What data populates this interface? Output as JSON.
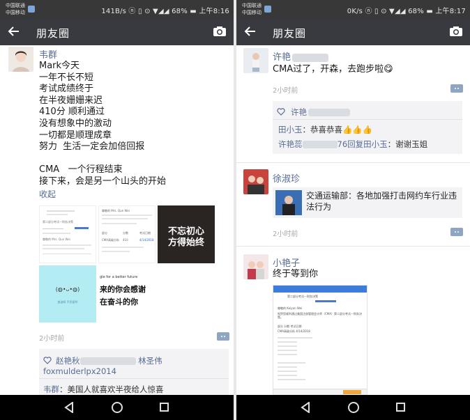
{
  "left": {
    "status": {
      "carrier1": "中国联通",
      "carrier2": "中国移动",
      "right": "141B/s ⓝ ▯ ⊙ ▼◢◢ 68% ▬ 上午8:16"
    },
    "title": "朋友圈",
    "post": {
      "author": "韦群",
      "text": "Mark今天\n一年不长不短\n考试成绩终于\n在半夜姗姗来迟\n410分 顺利通过\n没有想象中的激动\n一切都是顺理成章\n努力  生活一定会加倍回报\n\nCMA   一个行程结束\n接下来，会是另一个山头的开始",
      "collapse": "收起",
      "img_docA": {
        "label": "第二部分考试—财务决策",
        "name": "尊敬的 Mrs. Qun Wei"
      },
      "img_docB": {
        "name": "尊敬的 Mrs. Qun Wei",
        "head1": "部分",
        "head2": "分数",
        "head3": "考试日期",
        "row_part": "CMA高级分析",
        "row_score": "410",
        "row_date": "4/14/2018"
      },
      "img_dark": {
        "line1": "不忘初心",
        "line2": "方得始终"
      },
      "img_cyan": {
        "face": "(◍•ᴗ•◍)",
        "caption": "加油呀  不负韶华"
      },
      "img_calli": {
        "top": "gle for a better future",
        "line1": "来的你会感谢",
        "line2": "在奋斗的你"
      },
      "time": "2小时前",
      "likers": "赵艳秋",
      "likers2": "林圣伟",
      "likers3": "foxmulderlpx2014",
      "comment_author": "韦群",
      "comment_text": "：美国人就喜欢半夜给人惊喜"
    }
  },
  "right": {
    "status": {
      "carrier1": "中国联通",
      "carrier2": "中国移动",
      "right": "0K/s ⓝ ▯ ⊙ ▼◢◢ 68% ▬ 上午8:17"
    },
    "title": "朋友圈",
    "post1": {
      "author": "许艳",
      "text": "CMA过了，开森，去跑步啦😋",
      "time": "2小时前",
      "liker": "许艳",
      "comment1_author": "田小玉",
      "comment1_text": "：恭喜恭喜👍👍👍",
      "comment2_author": "许艳蕊",
      "comment2_mid": "76回复",
      "comment2_target": "田小玉",
      "comment2_text": "：谢谢玉姐"
    },
    "post2": {
      "author": "徐淑珍",
      "share_text": "交通运输部：各地加强打击网约车行业违法行为",
      "time": "2小时前"
    },
    "post3": {
      "author": "小艳子",
      "text": "终于等到你",
      "img_top": "第二部分考试—财务决策",
      "img_lines": [
        "尊敬的 Keiyan Wei",
        "祝贺您顺利通过美国注册管理会计师（CMA）第二部分考试—财务决策。",
        "部分    分数    考试日期",
        "CMA高级分析    4/14/2018"
      ]
    }
  },
  "colors": {
    "titlebar": "#393a3f",
    "statusbar": "#383838",
    "nickname": "#576b95",
    "time": "#a8a8a8"
  }
}
